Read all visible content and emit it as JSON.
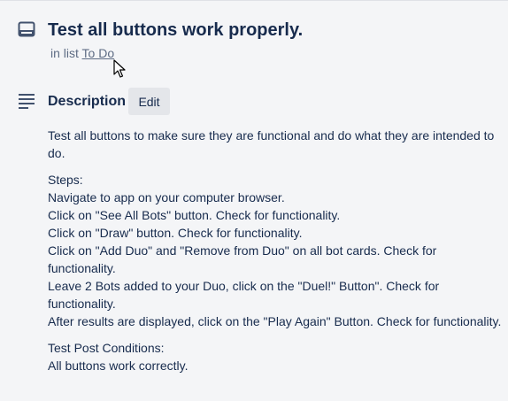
{
  "card": {
    "title": "Test all buttons work properly.",
    "list_prefix": "in list",
    "list_name": "To Do"
  },
  "description": {
    "heading": "Description",
    "edit_label": "Edit",
    "intro": "Test all buttons to make sure they are functional and do what they are intended to do.",
    "steps_heading": "Steps:",
    "steps": [
      "Navigate to app on your computer browser.",
      "Click on \"See All Bots\" button. Check for functionality.",
      "Click on \"Draw\" button. Check for functionality.",
      "Click on \"Add Duo\" and \"Remove from Duo\" on all bot cards. Check for functionality.",
      "Leave 2 Bots added to your Duo, click on the \"Duel!\" Button\". Check for functionality.",
      "After results are displayed, click on the \"Play Again\" Button. Check for functionality."
    ],
    "post_heading": "Test Post Conditions:",
    "post_text": "All buttons work correctly."
  },
  "icons": {
    "header": "card-icon",
    "description": "description-lines-icon",
    "cursor": "mouse-pointer-icon"
  },
  "colors": {
    "background": "#f4f5f7",
    "text": "#172b4d",
    "muted": "#5e6c84",
    "button_bg": "#e4e6ea"
  }
}
